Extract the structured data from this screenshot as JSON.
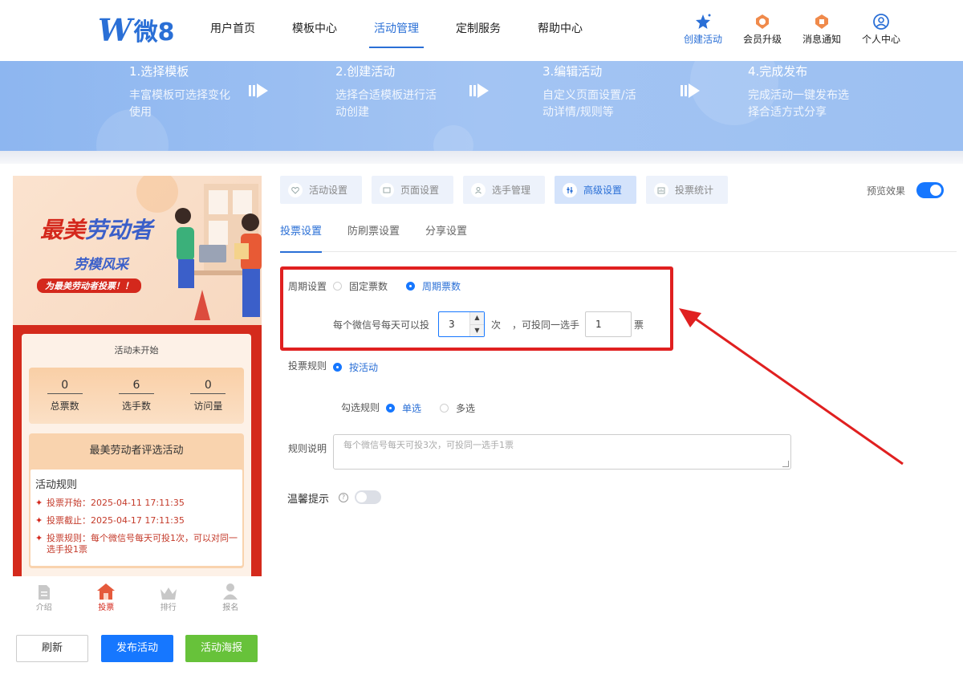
{
  "header": {
    "logo_text": "微8",
    "logo_letter": "W",
    "nav": [
      {
        "label": "用户首页"
      },
      {
        "label": "模板中心"
      },
      {
        "label": "活动管理"
      },
      {
        "label": "定制服务"
      },
      {
        "label": "帮助中心"
      }
    ],
    "actions": {
      "create": "创建活动",
      "upgrade": "会员升级",
      "messages": "消息通知",
      "profile": "个人中心"
    }
  },
  "banner": {
    "steps": [
      {
        "title": "1.选择模板",
        "desc": "丰富模板可选择变化使用"
      },
      {
        "title": "2.创建活动",
        "desc": "选择合适模板进行活动创建"
      },
      {
        "title": "3.编辑活动",
        "desc": "自定义页面设置/活动详情/规则等"
      },
      {
        "title": "4.完成发布",
        "desc": "完成活动一键发布选择合适方式分享"
      }
    ]
  },
  "preview": {
    "poster": {
      "title_red": "最美",
      "title_blue": "劳动者",
      "subtitle": "劳模风采",
      "tag": "为最美劳动者投票！！"
    },
    "status": "活动未开始",
    "stats": [
      {
        "value": "0",
        "label": "总票数"
      },
      {
        "value": "6",
        "label": "选手数"
      },
      {
        "value": "0",
        "label": "访问量"
      }
    ],
    "activity_title": "最美劳动者评选活动",
    "rules_title": "活动规则",
    "rules": [
      "投票开始：2025-04-11 17:11:35",
      "投票截止：2025-04-17 17:11:35",
      "投票规则：每个微信号每天可投1次，可以对同一选手投1票"
    ],
    "tabs": [
      {
        "label": "介绍"
      },
      {
        "label": "投票"
      },
      {
        "label": "排行"
      },
      {
        "label": "报名"
      }
    ]
  },
  "buttons": {
    "refresh": "刷新",
    "publish": "发布活动",
    "poster": "活动海报"
  },
  "settings": {
    "top_tabs": [
      {
        "label": "活动设置"
      },
      {
        "label": "页面设置"
      },
      {
        "label": "选手管理"
      },
      {
        "label": "高级设置"
      },
      {
        "label": "投票统计"
      }
    ],
    "preview_label": "预览效果",
    "sub_tabs": [
      {
        "label": "投票设置"
      },
      {
        "label": "防刷票设置"
      },
      {
        "label": "分享设置"
      }
    ],
    "cycle": {
      "label": "周期设置",
      "option_fixed": "固定票数",
      "option_cycle": "周期票数",
      "selected": "周期票数",
      "prefix": "每个微信号每天可以投",
      "times_value": "3",
      "times_unit": "次",
      "same_prefix": "，可投同一选手",
      "same_value": "1",
      "same_unit": "票"
    },
    "vote_rule": {
      "label": "投票规则",
      "option": "按活动"
    },
    "check_rule": {
      "label": "勾选规则",
      "single": "单选",
      "multi": "多选",
      "selected": "单选"
    },
    "rule_desc": {
      "label": "规则说明",
      "placeholder": "每个微信号每天可投3次，可投同一选手1票"
    },
    "tip": {
      "label": "温馨提示",
      "enabled": false
    }
  },
  "colors": {
    "primary": "#1677ff",
    "brand": "#2a6fd6",
    "highlight": "#e02020",
    "success": "#67c23a"
  }
}
